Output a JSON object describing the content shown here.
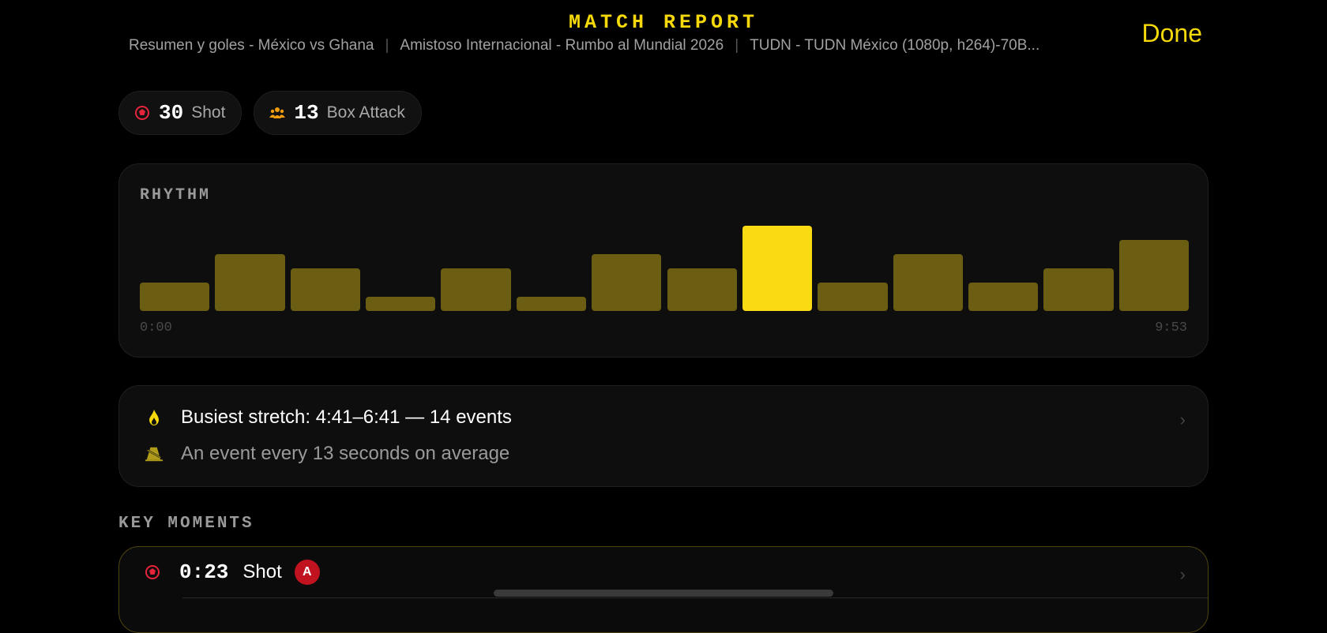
{
  "header": {
    "title": "MATCH REPORT",
    "subtitle_parts": [
      "Resumen y goles - México vs Ghana",
      "Amistoso Internacional - Rumbo al Mundial 2026",
      "TUDN - TUDN México (1080p, h264)-70B..."
    ],
    "separator": "|",
    "done_label": "Done"
  },
  "chips": [
    {
      "icon": "soccer-ball-icon",
      "count": "30",
      "label": "Shot",
      "icon_color": "#e5243b"
    },
    {
      "icon": "people-group-icon",
      "count": "13",
      "label": "Box Attack",
      "icon_color": "#f59e0b"
    }
  ],
  "rhythm": {
    "title": "RHYTHM",
    "start_label": "0:00",
    "end_label": "9:53",
    "colors": {
      "bar": "#6b5e12",
      "peak": "#f8db13"
    },
    "values": [
      2,
      4,
      3,
      1,
      3,
      1,
      4,
      3,
      6,
      2,
      4,
      2,
      3,
      5
    ],
    "peak_index": 8,
    "max_value": 6
  },
  "insights": {
    "busiest": {
      "icon": "flame-icon",
      "text": "Busiest stretch: 4:41–6:41 — 14 events"
    },
    "pace": {
      "icon": "metronome-icon",
      "text": "An event every 13 seconds on average"
    }
  },
  "key_moments": {
    "title": "KEY MOMENTS",
    "items": [
      {
        "icon": "soccer-ball-icon",
        "time": "0:23",
        "type": "Shot",
        "badge": "A"
      }
    ]
  },
  "accent_color": "#f5d90a"
}
